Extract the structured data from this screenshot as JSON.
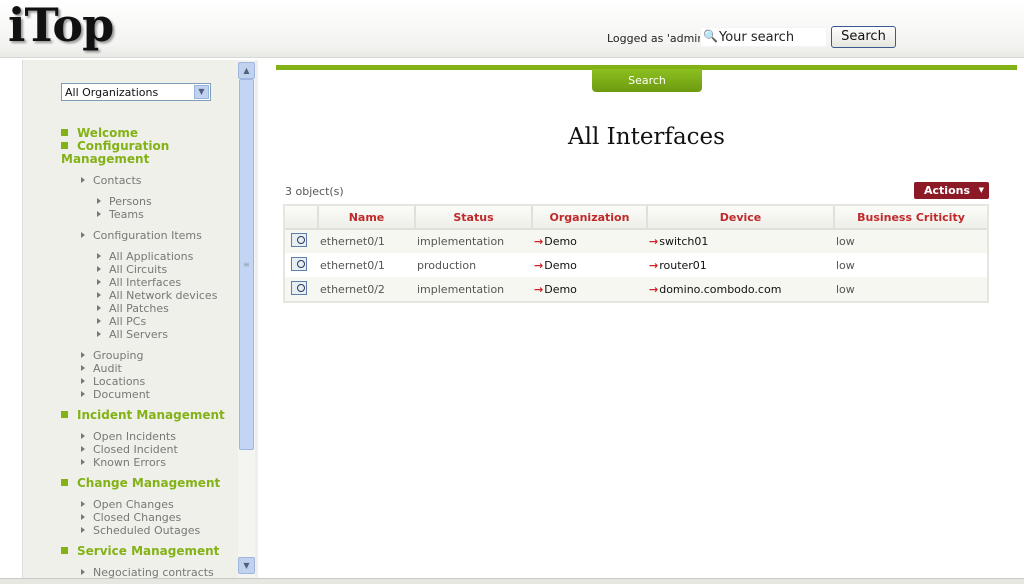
{
  "header": {
    "logo": "iTop",
    "logged_as": "Logged as 'admin'",
    "search_placeholder": "Your search",
    "search_button": "Search"
  },
  "sidebar": {
    "org_select": "All Organizations",
    "sections": [
      {
        "label": "Welcome"
      },
      {
        "label": "Configuration",
        "label2": "Management"
      }
    ],
    "config": {
      "contacts": "Contacts",
      "persons": "Persons",
      "teams": "Teams",
      "ci": "Configuration Items",
      "ci_items": [
        "All Applications",
        "All Circuits",
        "All Interfaces",
        "All Network devices",
        "All Patches",
        "All PCs",
        "All Servers"
      ],
      "grouping": "Grouping",
      "audit": "Audit",
      "locations": "Locations",
      "document": "Document"
    },
    "incident": {
      "title": "Incident Management",
      "items": [
        "Open Incidents",
        "Closed Incident",
        "Known Errors"
      ]
    },
    "change": {
      "title": "Change Management",
      "items": [
        "Open Changes",
        "Closed Changes",
        "Scheduled Outages"
      ]
    },
    "service": {
      "title": "Service Management",
      "items": [
        "Negociating contracts"
      ]
    }
  },
  "main": {
    "search_tab": "Search",
    "title": "All Interfaces",
    "object_count": "3 object(s)",
    "actions_label": "Actions",
    "table": {
      "headers": [
        "Name",
        "Status",
        "Organization",
        "Device",
        "Business Criticity"
      ],
      "rows": [
        {
          "name": "ethernet0/1",
          "status": "implementation",
          "org": "Demo",
          "device": "switch01",
          "crit": "low"
        },
        {
          "name": "ethernet0/1",
          "status": "production",
          "org": "Demo",
          "device": "router01",
          "crit": "low"
        },
        {
          "name": "ethernet0/2",
          "status": "implementation",
          "org": "Demo",
          "device": "domino.combodo.com",
          "crit": "low"
        }
      ]
    }
  }
}
